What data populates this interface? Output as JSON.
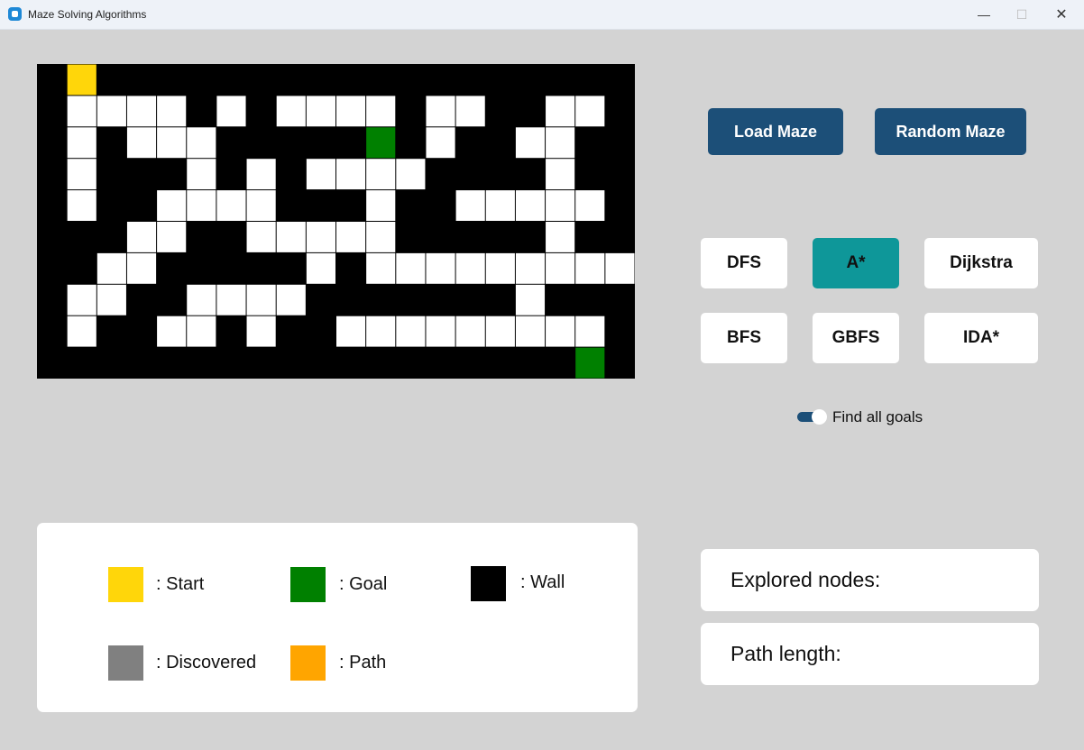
{
  "window": {
    "title": "Maze Solving Algorithms",
    "minimize": "—",
    "maximize": "☐",
    "close": "✕"
  },
  "maze": {
    "rows": [
      "#S##################",
      "#....#.#....#..##..#",
      "#.#...#####G#.##..##",
      "#.###.#.#....####.##",
      "#.##....###.##.....#",
      "###..##.....#####.##",
      "##..#####.#.........",
      "#..##....#######.###",
      "#.##..#.##.........#",
      "##################G#"
    ],
    "colors": {
      "wall": "#000000",
      "open": "#ffffff",
      "start": "#ffd60a",
      "goal": "#008000"
    }
  },
  "buttons": {
    "load": "Load Maze",
    "random": "Random Maze"
  },
  "algorithms": [
    "DFS",
    "A*",
    "Dijkstra",
    "BFS",
    "GBFS",
    "IDA*"
  ],
  "selected_algorithm": "A*",
  "toggle": {
    "label": "Find all goals",
    "on": true
  },
  "legend": [
    {
      "label": ": Start",
      "color": "#ffd60a"
    },
    {
      "label": ": Goal",
      "color": "#008000"
    },
    {
      "label": ": Wall",
      "color": "#000000"
    },
    {
      "label": ": Discovered",
      "color": "#808080"
    },
    {
      "label": ": Path",
      "color": "#ffa500"
    }
  ],
  "stats": {
    "explored_label": "Explored nodes:",
    "path_label": "Path length:"
  }
}
